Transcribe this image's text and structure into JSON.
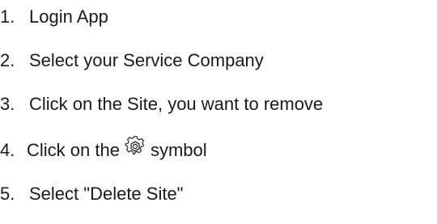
{
  "steps": [
    {
      "number": "1.",
      "text": "Login App"
    },
    {
      "number": "2.",
      "text": "Select your Service Company"
    },
    {
      "number": "3.",
      "text": "Click on the Site, you want to remove"
    },
    {
      "number": "4.",
      "text_before": "Click on the",
      "icon": "gear-icon",
      "text_after": "symbol"
    },
    {
      "number": "5.",
      "text": "Select \"Delete Site\""
    }
  ],
  "colors": {
    "text": "#1a1a1a",
    "background": "#ffffff"
  }
}
